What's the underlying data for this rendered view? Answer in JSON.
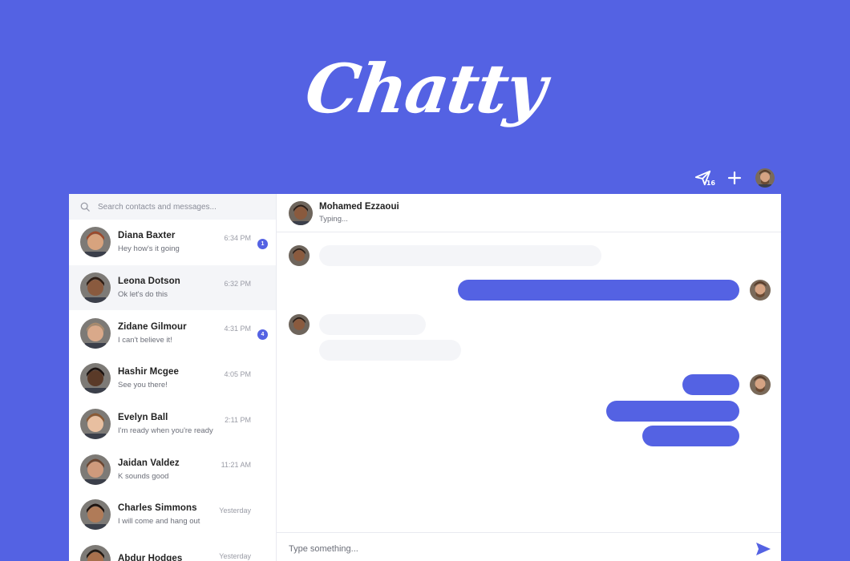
{
  "brand": {
    "logo_text": "Chatty"
  },
  "topbar": {
    "send_badge": "16"
  },
  "search": {
    "placeholder": "Search contacts and messages..."
  },
  "contacts": [
    {
      "name": "Diana Baxter",
      "message": "Hey how's it going",
      "time": "6:34 PM",
      "unread": "1",
      "skin": "#d7a37e",
      "hair": "#9c4a2c"
    },
    {
      "name": "Leona Dotson",
      "message": "Ok let's do this",
      "time": "6:32 PM",
      "unread": "",
      "skin": "#8a5a3e",
      "hair": "#2e1d14"
    },
    {
      "name": "Zidane Gilmour",
      "message": "I can't believe it!",
      "time": "4:31 PM",
      "unread": "4",
      "skin": "#d9a98a",
      "hair": "#a78a6e"
    },
    {
      "name": "Hashir Mcgee",
      "message": "See you there!",
      "time": "4:05 PM",
      "unread": "",
      "skin": "#5a3a28",
      "hair": "#1a1210"
    },
    {
      "name": "Evelyn Ball",
      "message": "I'm ready when you're ready",
      "time": "2:11 PM",
      "unread": "",
      "skin": "#e8bfa0",
      "hair": "#8a5a35"
    },
    {
      "name": "Jaidan Valdez",
      "message": "K sounds good",
      "time": "11:21 AM",
      "unread": "",
      "skin": "#cf9a7c",
      "hair": "#6a4530"
    },
    {
      "name": "Charles Simmons",
      "message": "I will come and hang out",
      "time": "Yesterday",
      "unread": "",
      "skin": "#b07b58",
      "hair": "#1e1410"
    },
    {
      "name": "Abdur Hodges",
      "message": "",
      "time": "Yesterday",
      "unread": "",
      "skin": "#a8704c",
      "hair": "#231a14"
    }
  ],
  "chat": {
    "contact_name": "Mohamed Ezzaoui",
    "status": "Typing...",
    "composer_placeholder": "Type something..."
  },
  "colors": {
    "accent": "#5462e3",
    "bubble_in": "#f4f5f8",
    "background": "#5462e3"
  }
}
